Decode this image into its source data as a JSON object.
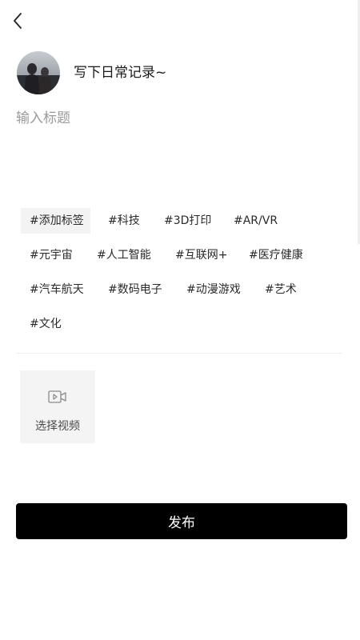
{
  "header": {
    "back_icon": "chevron-left-icon"
  },
  "profile": {
    "prompt": "写下日常记录~"
  },
  "title_input": {
    "placeholder": "输入标题",
    "value": ""
  },
  "tags": {
    "add_label": "#添加标签",
    "items": [
      "#科技",
      "#3D打印",
      "#AR/VR",
      "#元宇宙",
      "#人工智能",
      "#互联网+",
      "#医疗健康",
      "#汽车航天",
      "#数码电子",
      "#动漫游戏",
      "#艺术",
      "#文化"
    ]
  },
  "video": {
    "icon": "video-camera-icon",
    "label": "选择视频"
  },
  "publish": {
    "label": "发布"
  },
  "colors": {
    "background": "#ffffff",
    "primary_button": "#000000",
    "tag_highlight_bg": "#f3f3f3",
    "placeholder": "#9a9a9a"
  }
}
